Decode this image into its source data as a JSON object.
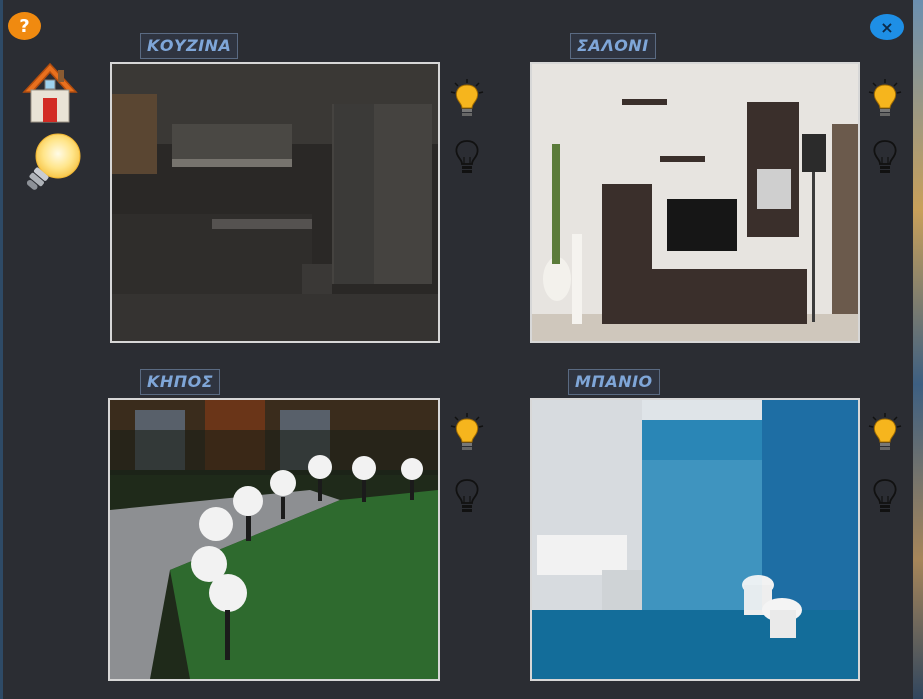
{
  "help": {
    "label": "?"
  },
  "close": {
    "label": "×"
  },
  "rooms": [
    {
      "label": "ΚΟΥΖΙΝΑ"
    },
    {
      "label": "ΣΑΛΟΝΙ"
    },
    {
      "label": "ΚΗΠΟΣ"
    },
    {
      "label": "ΜΠΑΝΙΟ"
    }
  ],
  "colors": {
    "background": "#2b2d33",
    "label_text": "#7fa6d8",
    "help_button": "#f08a10",
    "close_button": "#1e8fe6",
    "bulb_on": "#f6b51d"
  },
  "icons": {
    "sidebar": [
      "home-icon",
      "lightbulb-icon"
    ],
    "room_controls": [
      "lightbulb-on-icon",
      "lightbulb-off-icon"
    ]
  }
}
